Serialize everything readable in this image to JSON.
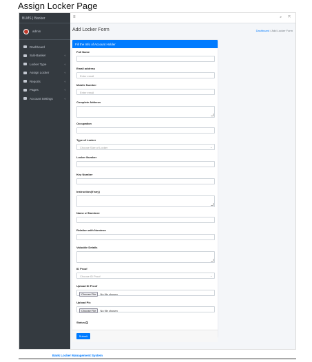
{
  "doc_title": "Assign Locker Page",
  "sidebar": {
    "brand": "BLMS | Banker",
    "user": "admin",
    "items": [
      {
        "label": "Dashboard",
        "icon": "dashboard-icon",
        "caret": false
      },
      {
        "label": "Sub-Banker",
        "icon": "users-icon",
        "caret": true
      },
      {
        "label": "Locker Type",
        "icon": "users-icon",
        "caret": true
      },
      {
        "label": "Assign Locker",
        "icon": "file-icon",
        "caret": true
      },
      {
        "label": "Reports",
        "icon": "table-icon",
        "caret": true
      },
      {
        "label": "Pages",
        "icon": "file-icon",
        "caret": true
      },
      {
        "label": "Account Settings",
        "icon": "users-icon",
        "caret": true
      }
    ]
  },
  "topbar": {
    "menu_icon": "≡",
    "search_icon": "⌕",
    "expand_icon": "⤧"
  },
  "header": {
    "title": "Add Locker Form",
    "breadcrumb": {
      "home": "Dashboard",
      "sep": "/",
      "current": "Add Locker Form"
    }
  },
  "card": {
    "header": "Fill the Info of Account Holder",
    "fields": {
      "full_name": {
        "label": "Full Name"
      },
      "email": {
        "label": "Email address",
        "placeholder": "Enter email"
      },
      "mobile": {
        "label": "Mobile Number",
        "placeholder": "Enter email"
      },
      "address": {
        "label": "Complete Address"
      },
      "occupation": {
        "label": "Occupation"
      },
      "locker_type": {
        "label": "Type of Locker",
        "selected": "Choose Size of Locker"
      },
      "locker_number": {
        "label": "Locker Number"
      },
      "key_number": {
        "label": "Key Number"
      },
      "instruction": {
        "label": "Instruction(if any)"
      },
      "nominee_name": {
        "label": "Name of Nominee"
      },
      "nominee_relation": {
        "label": "Relation with Nominee"
      },
      "valuable": {
        "label": "Valuable Details"
      },
      "id_proof": {
        "label": "ID Proof",
        "selected": "Choose ID Proof"
      },
      "upload_id": {
        "label": "Upload ID Proof",
        "button": "Choose File",
        "status": "No file chosen"
      },
      "upload_pic": {
        "label": "Upload Pic",
        "button": "Choose File",
        "status": "No file chosen"
      },
      "status": {
        "label": "Status"
      }
    },
    "submit": "Submit"
  },
  "footer": "Bank Locker Management System"
}
